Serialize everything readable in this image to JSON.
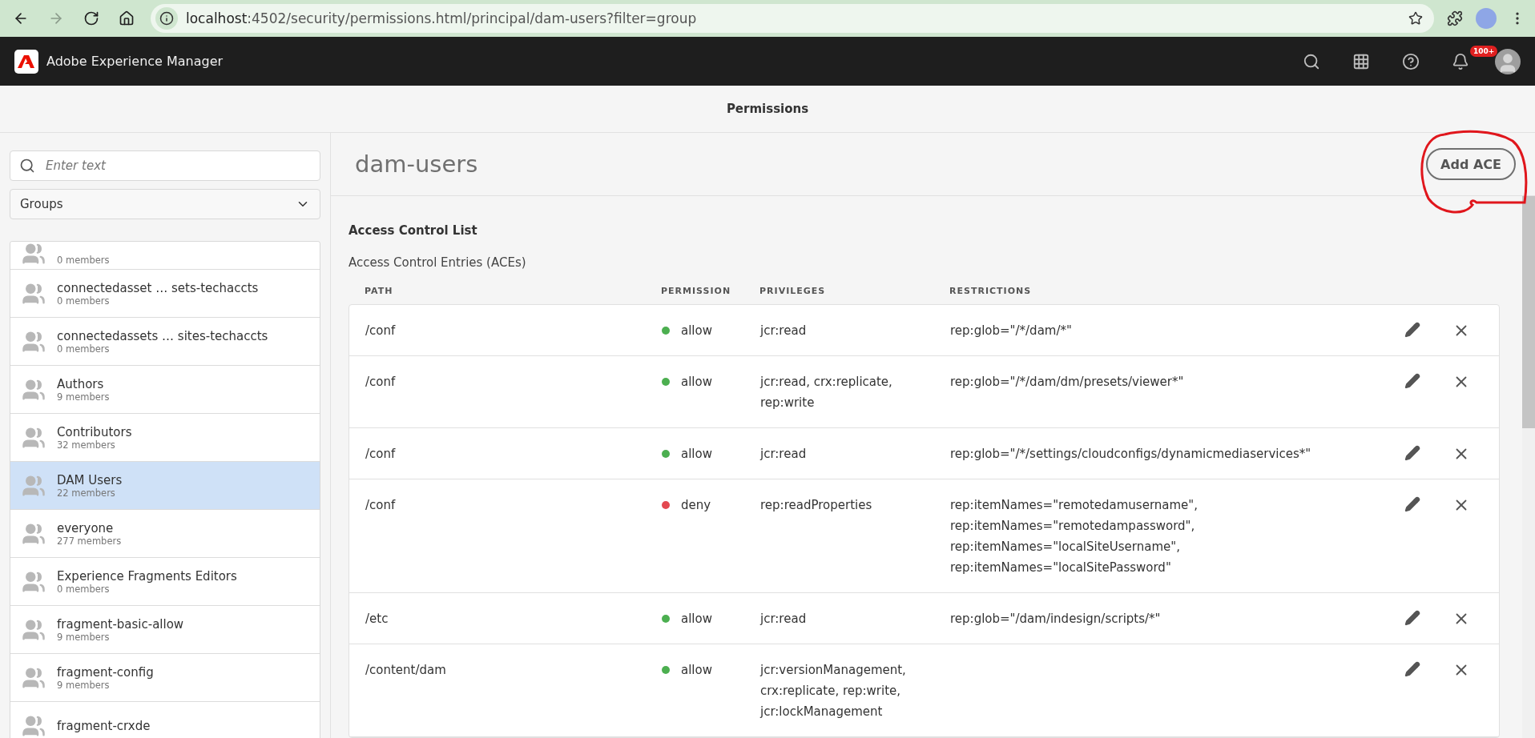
{
  "browser": {
    "url_host": "localhost",
    "url_rest": ":4502/security/permissions.html/principal/dam-users?filter=group",
    "forward_disabled": true
  },
  "app_header": {
    "title": "Adobe Experience Manager",
    "notification_badge": "100+"
  },
  "page_title": "Permissions",
  "sidebar": {
    "search": {
      "placeholder": "Enter text"
    },
    "filter": {
      "value": "Groups"
    },
    "items": [
      {
        "members": "0 members",
        "selected": false
      },
      {
        "name": "connectedasset … sets-techaccts",
        "members": "0 members",
        "selected": false
      },
      {
        "name": "connectedassets … sites-techaccts",
        "members": "0 members",
        "selected": false
      },
      {
        "name": "Authors",
        "members": "9 members",
        "selected": false
      },
      {
        "name": "Contributors",
        "members": "32 members",
        "selected": false
      },
      {
        "name": "DAM Users",
        "members": "22 members",
        "selected": true
      },
      {
        "name": "everyone",
        "members": "277 members",
        "selected": false
      },
      {
        "name": "Experience Fragments Editors",
        "members": "0 members",
        "selected": false
      },
      {
        "name": "fragment-basic-allow",
        "members": "9 members",
        "selected": false
      },
      {
        "name": "fragment-config",
        "members": "9 members",
        "selected": false
      },
      {
        "name": "fragment-crxde",
        "selected": false
      }
    ]
  },
  "principal": {
    "title": "dam-users",
    "add_button": "Add ACE"
  },
  "acl": {
    "heading": "Access Control List",
    "subheading": "Access Control Entries (ACEs)",
    "columns": [
      "PATH",
      "PERMISSION",
      "PRIVILEGES",
      "RESTRICTIONS"
    ],
    "rows": [
      {
        "path": "/conf",
        "permission": "allow",
        "color": "#4caf50",
        "privileges": [
          "jcr:read"
        ],
        "restrictions": [
          "rep:glob=\"/*/dam/*\""
        ]
      },
      {
        "path": "/conf",
        "permission": "allow",
        "color": "#4caf50",
        "privileges": [
          "jcr:read, crx:replicate,",
          "rep:write"
        ],
        "restrictions": [
          "rep:glob=\"/*/dam/dm/presets/viewer*\""
        ]
      },
      {
        "path": "/conf",
        "permission": "allow",
        "color": "#4caf50",
        "privileges": [
          "jcr:read"
        ],
        "restrictions": [
          "rep:glob=\"/*/settings/cloudconfigs/dynamicmediaservices*\""
        ]
      },
      {
        "path": "/conf",
        "permission": "deny",
        "color": "#e34850",
        "privileges": [
          "rep:readProperties"
        ],
        "restrictions": [
          "rep:itemNames=\"remotedamusername\",",
          "rep:itemNames=\"remotedampassword\",",
          "rep:itemNames=\"localSiteUsername\",",
          "rep:itemNames=\"localSitePassword\""
        ]
      },
      {
        "path": "/etc",
        "permission": "allow",
        "color": "#4caf50",
        "privileges": [
          "jcr:read"
        ],
        "restrictions": [
          "rep:glob=\"/dam/indesign/scripts/*\""
        ]
      },
      {
        "path": "/content/dam",
        "permission": "allow",
        "color": "#4caf50",
        "privileges": [
          "jcr:versionManagement,",
          "crx:replicate, rep:write,",
          "jcr:lockManagement"
        ],
        "restrictions": []
      }
    ]
  }
}
